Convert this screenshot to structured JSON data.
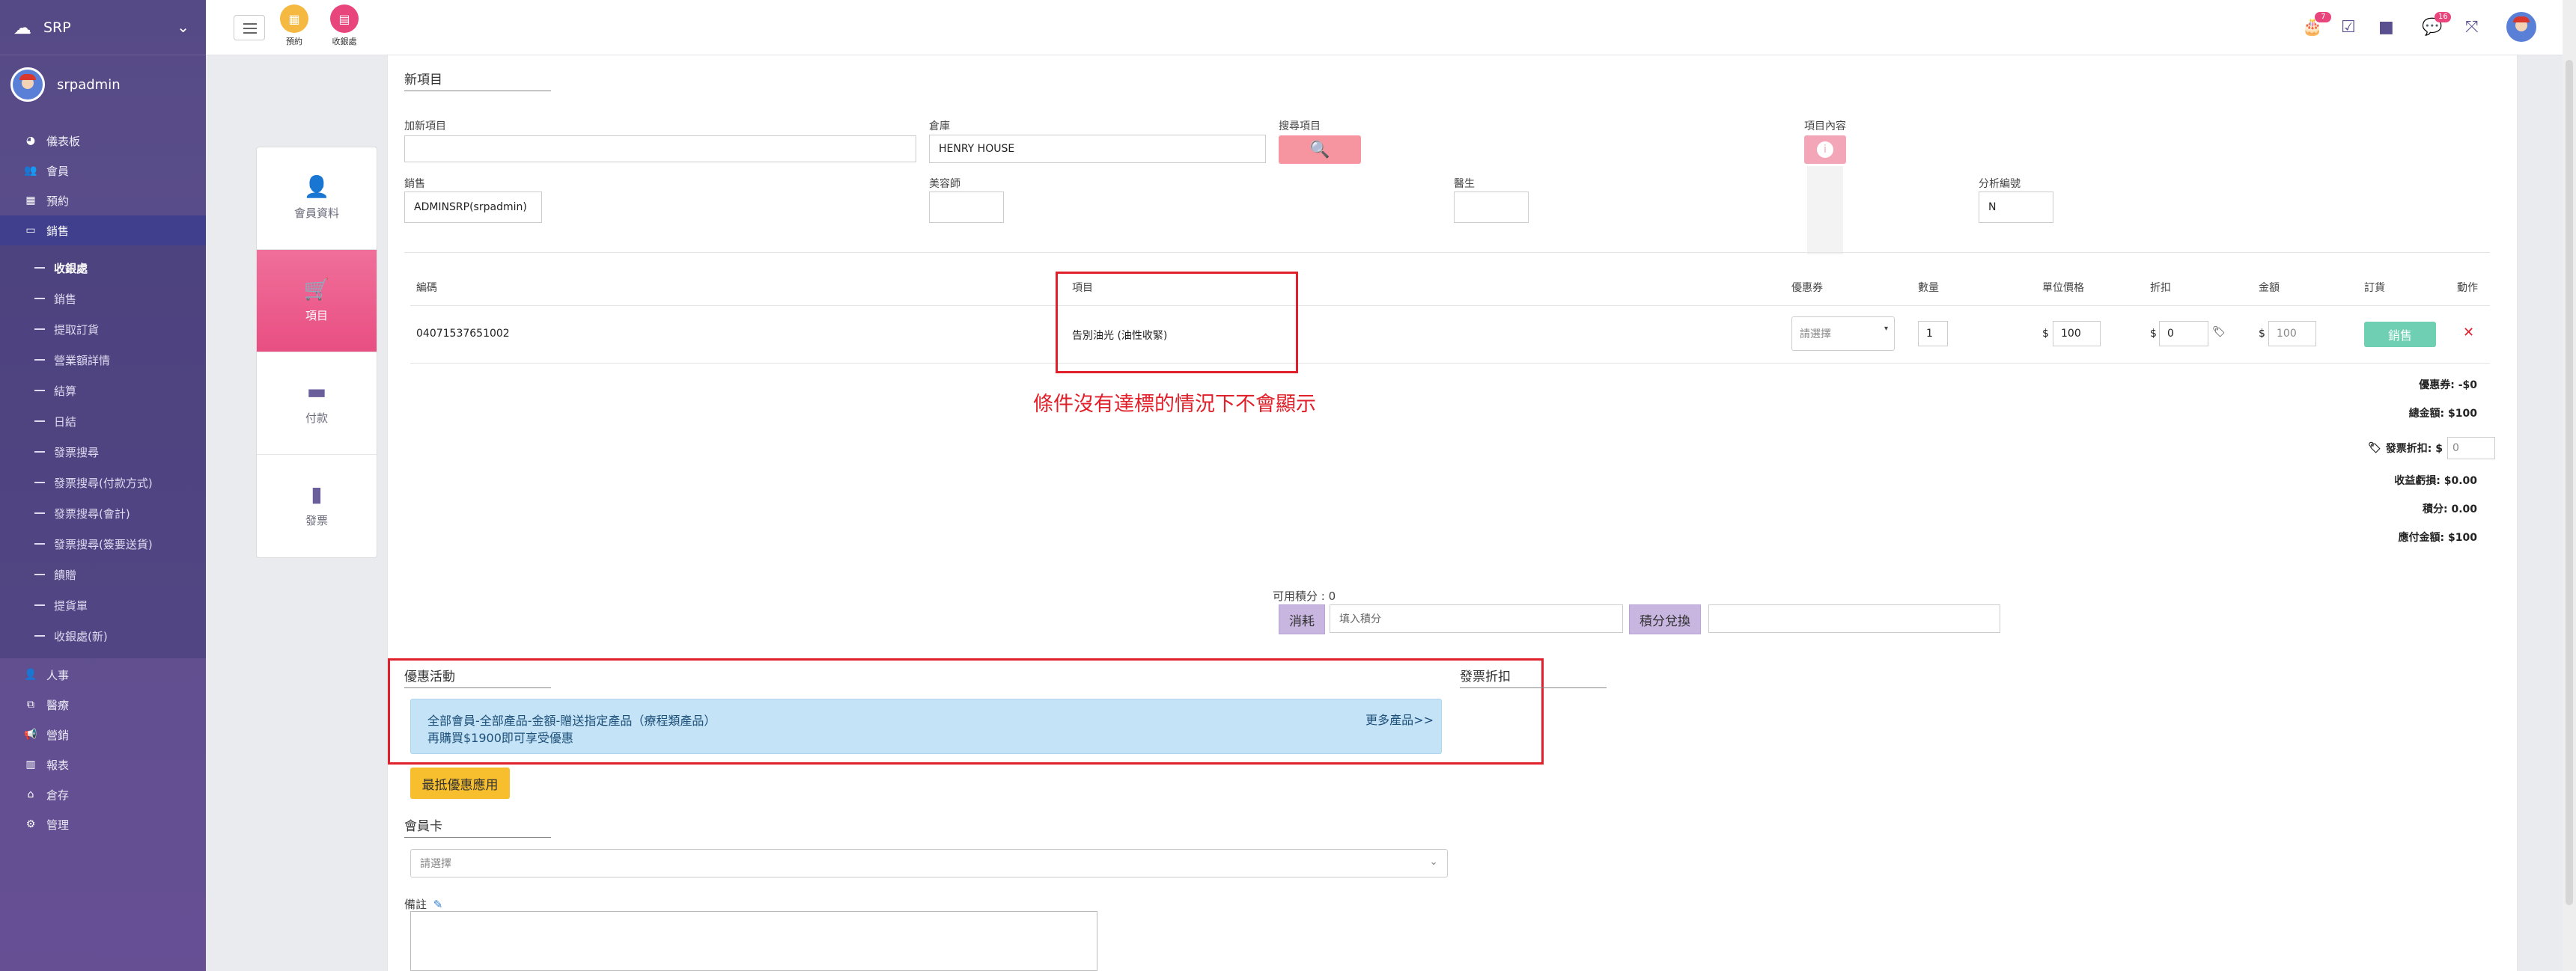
{
  "app": {
    "name": "SRP",
    "username": "srpadmin"
  },
  "sidebar": {
    "items": [
      {
        "label": "儀表板",
        "icon": "palette-icon"
      },
      {
        "label": "會員",
        "icon": "users-icon"
      },
      {
        "label": "預約",
        "icon": "calendar-icon"
      },
      {
        "label": "銷售",
        "icon": "card-icon"
      }
    ],
    "sub_items": [
      "收銀處",
      "銷售",
      "提取訂貨",
      "營業額詳情",
      "結算",
      "日結",
      "發票搜尋",
      "發票搜尋(付款方式)",
      "發票搜尋(會計)",
      "發票搜尋(簽要送貨)",
      "饋贈",
      "提貨單",
      "收銀處(新)"
    ],
    "bottom_items": [
      {
        "label": "人事",
        "icon": "user-icon"
      },
      {
        "label": "醫療",
        "icon": "copy-icon"
      },
      {
        "label": "營銷",
        "icon": "bullhorn-icon"
      },
      {
        "label": "報表",
        "icon": "chart-icon"
      },
      {
        "label": "倉存",
        "icon": "warehouse-icon"
      },
      {
        "label": "管理",
        "icon": "gear-icon"
      }
    ]
  },
  "topbar": {
    "quick": [
      {
        "label": "預約",
        "color": "#f5b942"
      },
      {
        "label": "收銀處",
        "color": "#e8457c"
      }
    ],
    "badges": {
      "birthday": "7",
      "chat": "16"
    }
  },
  "steps": [
    "會員資料",
    "項目",
    "付款",
    "發票"
  ],
  "form": {
    "title": "新項目",
    "add_item_label": "加新項目",
    "warehouse_label": "倉庫",
    "warehouse_value": "HENRY HOUSE",
    "search_label": "搜尋項目",
    "content_label": "項目內容",
    "sales_label": "銷售",
    "sales_value": "ADMINSRP(srpadmin)",
    "beautician_label": "美容師",
    "doctor_label": "醫生",
    "analysis_label": "分析編號",
    "analysis_value": "N"
  },
  "table": {
    "headers": [
      "編碼",
      "項目",
      "優惠券",
      "數量",
      "單位價格",
      "折扣",
      "金額",
      "訂貨",
      "動作"
    ],
    "row": {
      "code": "04071537651002",
      "item": "告別油光 (油性收緊)",
      "coupon": "請選擇",
      "qty": "1",
      "unit_price": "100",
      "discount": "0",
      "amount": "100",
      "order_btn": "銷售",
      "currency": "$"
    }
  },
  "annotation": "條件沒有達標的情況下不會顯示",
  "summary": {
    "coupon": "優惠券: -$0",
    "total": "總金額: $100",
    "invoice_discount_label": "發票折扣: $",
    "invoice_discount_value": "0",
    "revenue": "收益虧損: $0.00",
    "points": "積分: 0.00",
    "payable": "應付金額: $100"
  },
  "points": {
    "available": "可用積分 :  0",
    "consume_btn": "消耗",
    "placeholder": "填入積分",
    "redeem_btn": "積分兌換"
  },
  "promo": {
    "title": "優惠活動",
    "invoice_discount_title": "發票折扣",
    "line1": "全部會員-全部產品-金額-贈送指定產品（療程類產品）",
    "line2": "再購買$1900即可享受優惠",
    "more": "更多產品>>",
    "apply_btn": "最抵優惠應用"
  },
  "member_card": {
    "label": "會員卡",
    "placeholder": "請選擇"
  },
  "remark": {
    "label": "備註"
  }
}
